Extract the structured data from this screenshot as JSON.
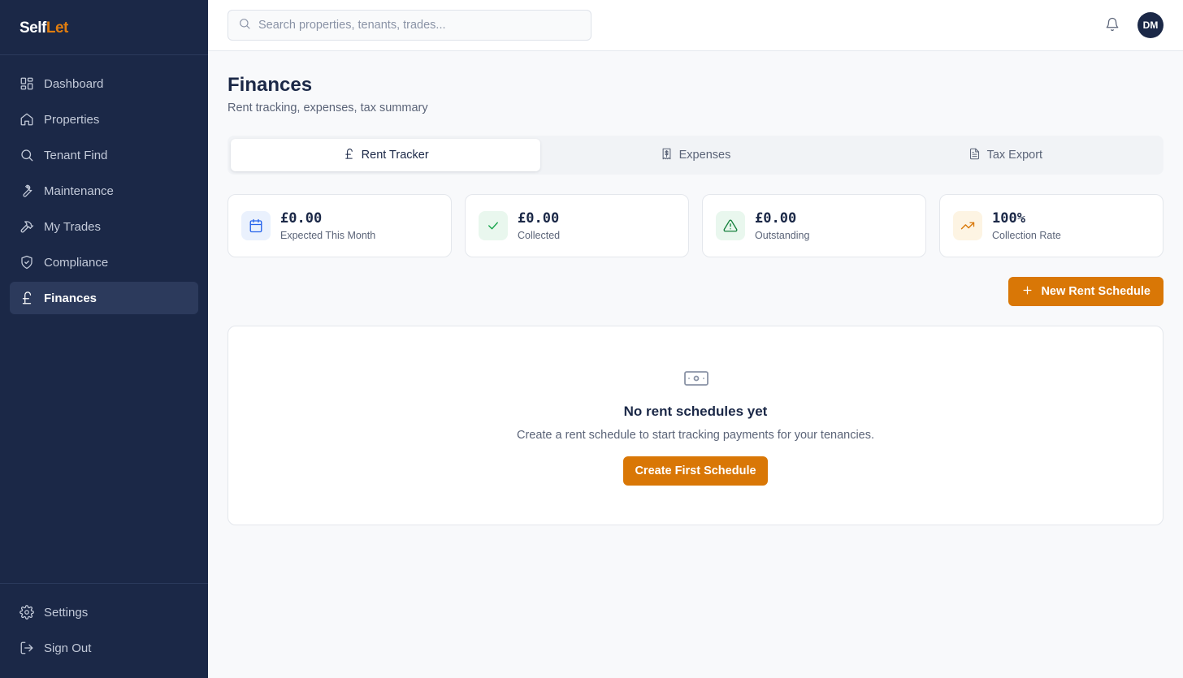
{
  "brand": {
    "part1": "Self",
    "part2": "Let"
  },
  "sidebar": {
    "items": [
      {
        "label": "Dashboard",
        "icon": "dashboard-icon"
      },
      {
        "label": "Properties",
        "icon": "home-icon"
      },
      {
        "label": "Tenant Find",
        "icon": "search-icon"
      },
      {
        "label": "Maintenance",
        "icon": "wrench-icon"
      },
      {
        "label": "My Trades",
        "icon": "hammer-icon"
      },
      {
        "label": "Compliance",
        "icon": "shield-check-icon"
      },
      {
        "label": "Finances",
        "icon": "pound-icon",
        "active": true
      }
    ],
    "bottom": [
      {
        "label": "Settings",
        "icon": "gear-icon"
      },
      {
        "label": "Sign Out",
        "icon": "sign-out-icon"
      }
    ]
  },
  "header": {
    "search_placeholder": "Search properties, tenants, trades...",
    "avatar_initials": "DM"
  },
  "page": {
    "title": "Finances",
    "subtitle": "Rent tracking, expenses, tax summary"
  },
  "tabs": [
    {
      "label": "Rent Tracker",
      "icon": "pound-icon",
      "active": true
    },
    {
      "label": "Expenses",
      "icon": "receipt-icon"
    },
    {
      "label": "Tax Export",
      "icon": "document-icon"
    }
  ],
  "stats": [
    {
      "value": "£0.00",
      "label": "Expected This Month",
      "icon": "calendar-icon",
      "color": "#2563eb",
      "bg": "#eaf1fd"
    },
    {
      "value": "£0.00",
      "label": "Collected",
      "icon": "check-icon",
      "color": "#16a34a",
      "bg": "#e9f7ee"
    },
    {
      "value": "£0.00",
      "label": "Outstanding",
      "icon": "warning-icon",
      "color": "#15803d",
      "bg": "#e9f7ee"
    },
    {
      "value": "100%",
      "label": "Collection Rate",
      "icon": "trending-up-icon",
      "color": "#d97706",
      "bg": "#fdf4e3"
    }
  ],
  "actions": {
    "new_schedule": "New Rent Schedule"
  },
  "empty_state": {
    "icon": "banknote-icon",
    "title": "No rent schedules yet",
    "text": "Create a rent schedule to start tracking payments for your tenancies.",
    "button": "Create First Schedule"
  },
  "colors": {
    "sidebar": "#1b2847",
    "accent": "#d97706"
  }
}
